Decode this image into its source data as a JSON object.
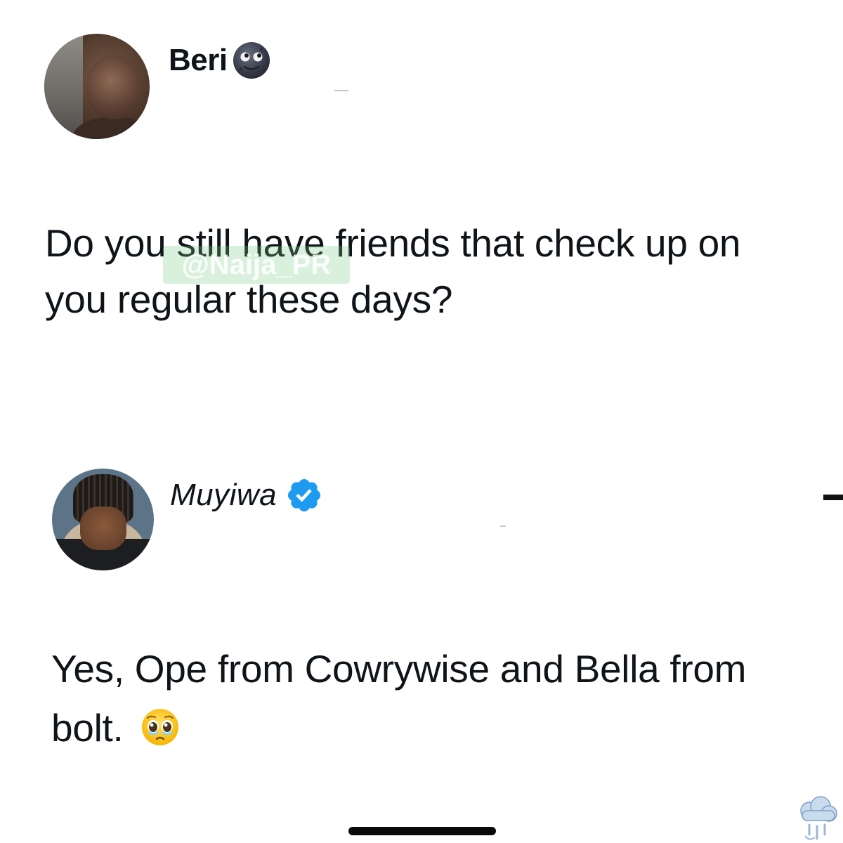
{
  "tweets": [
    {
      "author": "Beri",
      "name_emoji": "moon-face-icon",
      "text": "Do you still have friends that check up on you regular these days?",
      "watermark": "@Naija_PR"
    },
    {
      "author": "Muyiwa",
      "verified": true,
      "text": "Yes, Ope from Cowrywise and Bella from bolt.",
      "text_emoji": "pleading-face-icon"
    }
  ],
  "colors": {
    "text": "#0f1419",
    "verified": "#1d9bf0",
    "home_indicator": "#0a0a0a"
  }
}
